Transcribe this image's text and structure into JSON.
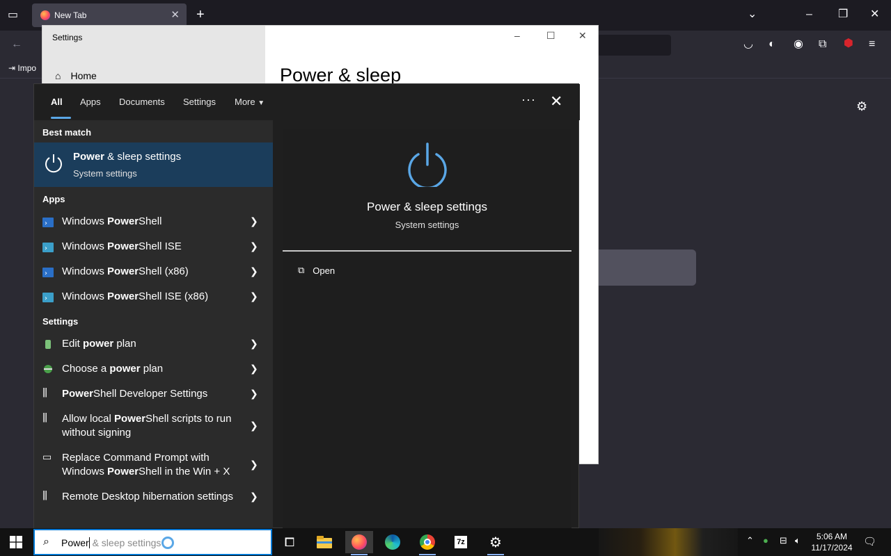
{
  "browser": {
    "tab_title": "New Tab",
    "bookmark_import_label": "Impo"
  },
  "settings_window": {
    "title": "Settings",
    "nav_home": "Home",
    "heading": "Power & sleep"
  },
  "search_flyout": {
    "tabs": [
      "All",
      "Apps",
      "Documents",
      "Settings",
      "More"
    ],
    "best_match_header": "Best match",
    "best_match": {
      "title_bold": "Power",
      "title_rest": " & sleep settings",
      "subtitle": "System settings"
    },
    "apps_header": "Apps",
    "apps": [
      {
        "pre": "Windows ",
        "bold": "Power",
        "post": "Shell"
      },
      {
        "pre": "Windows ",
        "bold": "Power",
        "post": "Shell ISE"
      },
      {
        "pre": "Windows ",
        "bold": "Power",
        "post": "Shell (x86)"
      },
      {
        "pre": "Windows ",
        "bold": "Power",
        "post": "Shell ISE (x86)"
      }
    ],
    "settings_header": "Settings",
    "settings_items": [
      {
        "pre": "Edit ",
        "bold": "power",
        "post": " plan"
      },
      {
        "pre": "Choose a ",
        "bold": "power",
        "post": " plan"
      },
      {
        "pre": "",
        "bold": "Power",
        "post": "Shell Developer Settings"
      },
      {
        "pre": "Allow local ",
        "bold": "Power",
        "post": "Shell scripts to run without signing"
      },
      {
        "pre": "Replace Command Prompt with Windows ",
        "bold": "Power",
        "post": "Shell in the Win + X"
      },
      {
        "pre": "Remote Desktop hibernation settings",
        "bold": "",
        "post": ""
      }
    ],
    "preview": {
      "title": "Power & sleep settings",
      "subtitle": "System settings",
      "open_label": "Open"
    }
  },
  "taskbar": {
    "search_typed": "Power",
    "search_suggestion": " & sleep settings",
    "time": "5:06 AM",
    "date": "11/17/2024"
  },
  "colors": {
    "accent": "#5aa7e6",
    "best_match_bg": "#1b3d5b",
    "flyout_bg": "#2b2b2b"
  }
}
